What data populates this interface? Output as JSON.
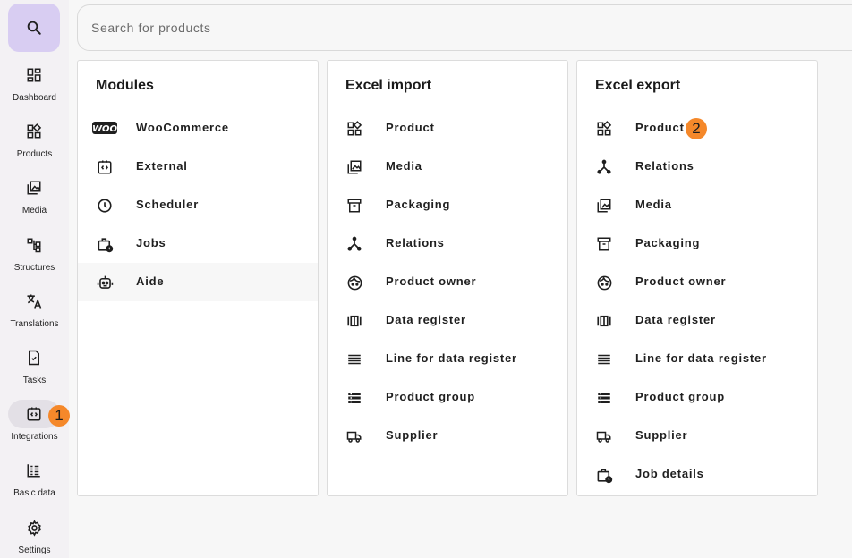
{
  "sidebar": {
    "items": [
      {
        "label": "Dashboard"
      },
      {
        "label": "Products"
      },
      {
        "label": "Media"
      },
      {
        "label": "Structures"
      },
      {
        "label": "Translations"
      },
      {
        "label": "Tasks"
      },
      {
        "label": "Integrations",
        "badge": "1"
      },
      {
        "label": "Basic data"
      },
      {
        "label": "Settings"
      }
    ]
  },
  "search": {
    "placeholder": "Search for products",
    "value": ""
  },
  "cards": [
    {
      "title": "Modules",
      "items": [
        {
          "label": "WooCommerce",
          "icon": "woocommerce-icon"
        },
        {
          "label": "External",
          "icon": "integration-icon"
        },
        {
          "label": "Scheduler",
          "icon": "clock-icon"
        },
        {
          "label": "Jobs",
          "icon": "job-icon"
        },
        {
          "label": "Aide",
          "icon": "robot-icon"
        }
      ]
    },
    {
      "title": "Excel import",
      "items": [
        {
          "label": "Product",
          "icon": "product-icon"
        },
        {
          "label": "Media",
          "icon": "media-icon"
        },
        {
          "label": "Packaging",
          "icon": "archive-icon"
        },
        {
          "label": "Relations",
          "icon": "relations-icon"
        },
        {
          "label": "Product owner",
          "icon": "face-icon"
        },
        {
          "label": "Data register",
          "icon": "data-register-icon"
        },
        {
          "label": "Line for data register",
          "icon": "lines-icon"
        },
        {
          "label": "Product group",
          "icon": "list-group-icon"
        },
        {
          "label": "Supplier",
          "icon": "truck-icon"
        }
      ]
    },
    {
      "title": "Excel export",
      "items": [
        {
          "label": "Product",
          "icon": "product-icon",
          "badge": "2"
        },
        {
          "label": "Relations",
          "icon": "relations-icon"
        },
        {
          "label": "Media",
          "icon": "media-icon"
        },
        {
          "label": "Packaging",
          "icon": "archive-icon"
        },
        {
          "label": "Product owner",
          "icon": "face-icon"
        },
        {
          "label": "Data register",
          "icon": "data-register-icon"
        },
        {
          "label": "Line for data register",
          "icon": "lines-icon"
        },
        {
          "label": "Product group",
          "icon": "list-group-icon"
        },
        {
          "label": "Supplier",
          "icon": "truck-icon"
        },
        {
          "label": "Job details",
          "icon": "job-icon"
        }
      ]
    }
  ],
  "colors": {
    "accent": "#d8cdf2",
    "badge": "#f5882a",
    "active": "#e3e0e6"
  }
}
